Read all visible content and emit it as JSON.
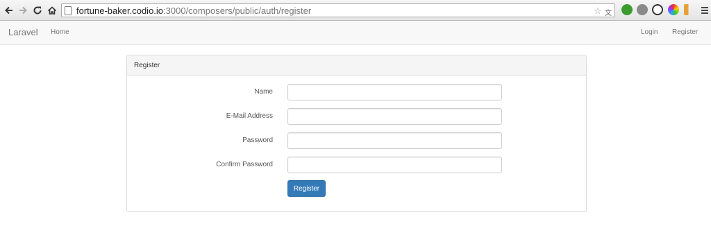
{
  "browser": {
    "url_host": "fortune-baker.codio.io",
    "url_rest": ":3000/composers/public/auth/register"
  },
  "navbar": {
    "brand": "Laravel",
    "home": "Home",
    "login": "Login",
    "register": "Register"
  },
  "panel": {
    "heading": "Register"
  },
  "form": {
    "name_label": "Name",
    "email_label": "E-Mail Address",
    "password_label": "Password",
    "confirm_label": "Confirm Password",
    "name_value": "",
    "email_value": "",
    "password_value": "",
    "confirm_value": "",
    "submit_label": "Register"
  },
  "colors": {
    "primary_button": "#337ab7",
    "navbar_bg": "#f8f8f8"
  }
}
